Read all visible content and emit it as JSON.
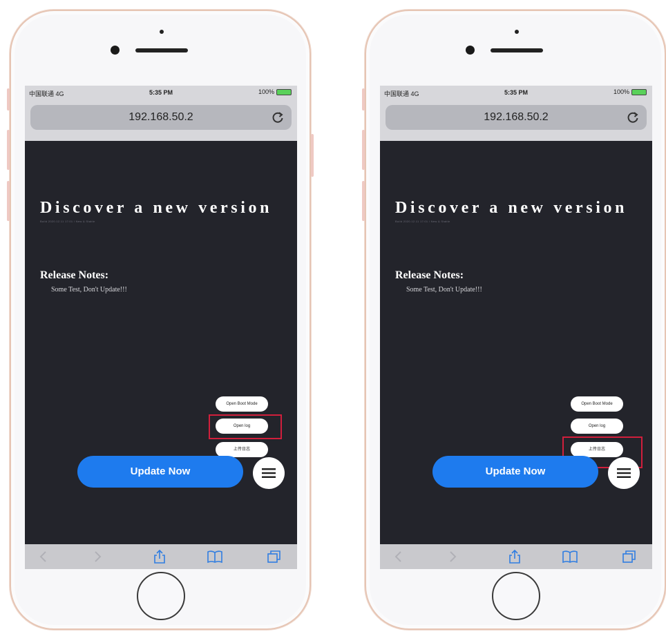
{
  "phones": [
    {
      "status": {
        "carrier": "中国联通 4G",
        "time": "5:35 PM",
        "battery": "100%"
      },
      "url": "192.168.50.2",
      "title": "Discover a new version",
      "subtitle": "Build 2020.12.11 17:01 / New & Stable",
      "notes_heading": "Release Notes:",
      "notes_text": "Some Test,   Don't Update!!!",
      "update_label": "Update Now",
      "menu": [
        "Open Boot Mode",
        "Open log",
        "上传日志"
      ],
      "highlighted_menu_index": 1
    },
    {
      "status": {
        "carrier": "中国联通 4G",
        "time": "5:35 PM",
        "battery": "100%"
      },
      "url": "192.168.50.2",
      "title": "Discover a new version",
      "subtitle": "Build 2020.12.11 17:01 / New & Stable",
      "notes_heading": "Release Notes:",
      "notes_text": "Some Test,   Don't Update!!!",
      "update_label": "Update Now",
      "menu": [
        "Open Boot Mode",
        "Open log",
        "上传日志"
      ],
      "highlighted_menu_index": 2
    }
  ],
  "colors": {
    "screen_bg": "#23242b",
    "update_button": "#1e7bee",
    "highlight": "#d11f3c",
    "phone_frame": "#e6c5b4"
  },
  "icons": [
    "reload-icon",
    "back-icon",
    "forward-icon",
    "share-icon",
    "bookmarks-icon",
    "tabs-icon",
    "hamburger-icon"
  ]
}
